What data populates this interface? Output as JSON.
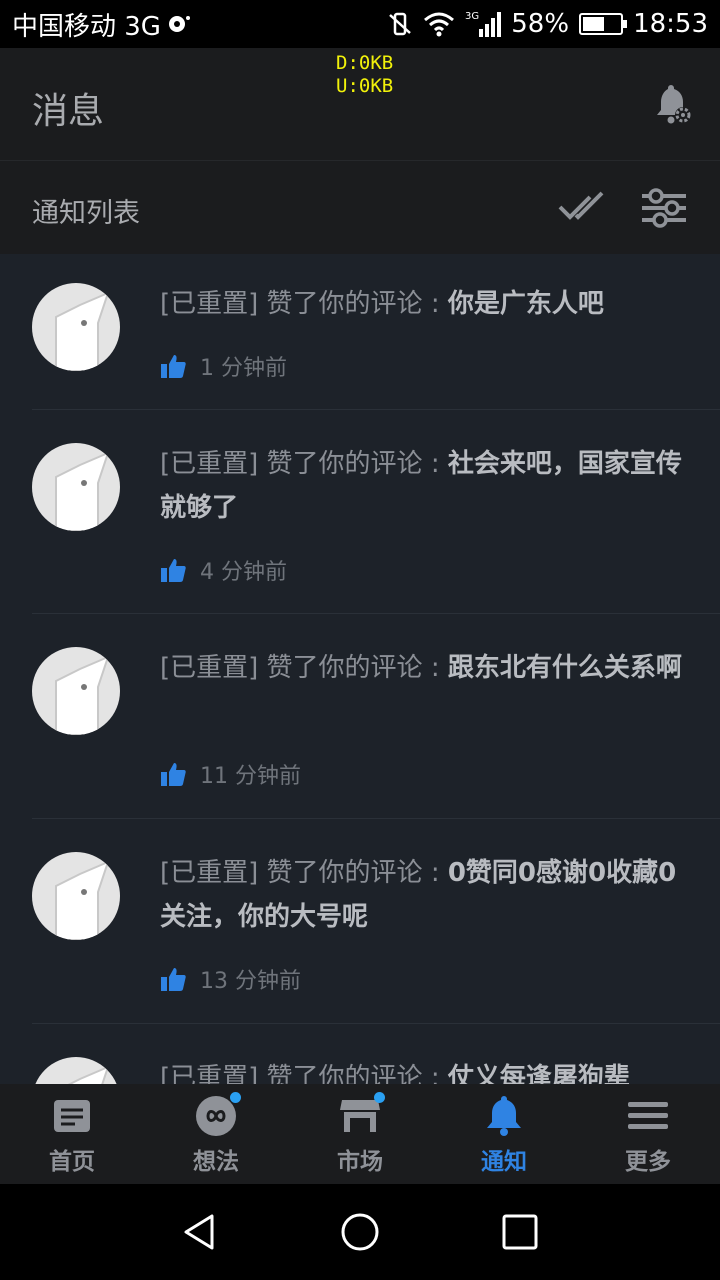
{
  "status": {
    "carrier": "中国移动 3G",
    "battery": "58%",
    "battery_level": 0.58,
    "time": "18:53"
  },
  "net": {
    "down": "D:0KB",
    "up": "U:0KB"
  },
  "header": {
    "title": "消息"
  },
  "sub_header": {
    "label": "通知列表"
  },
  "notifications": [
    {
      "prefix": "[已重置] 赞了你的评论 : ",
      "content": "你是广东人吧",
      "time": "1 分钟前"
    },
    {
      "prefix": "[已重置] 赞了你的评论 : ",
      "content": "社会来吧，国家宣传就够了",
      "time": "4 分钟前"
    },
    {
      "prefix": "[已重置] 赞了你的评论 : ",
      "content": "跟东北有什么关系啊",
      "time": "11 分钟前"
    },
    {
      "prefix": "[已重置] 赞了你的评论 : ",
      "content": "0赞同0感谢0收藏0关注，你的大号呢",
      "time": "13 分钟前"
    },
    {
      "prefix": "[已重置] 赞了你的评论 : ",
      "content": "仗义每逢屠狗辈",
      "time": ""
    }
  ],
  "nav": {
    "home": "首页",
    "ideas": "想法",
    "market": "市场",
    "notify": "通知",
    "more": "更多"
  },
  "colors": {
    "accent": "#2f83e3",
    "list_bg": "#1d2229",
    "header_bg": "#1b1c1e"
  }
}
